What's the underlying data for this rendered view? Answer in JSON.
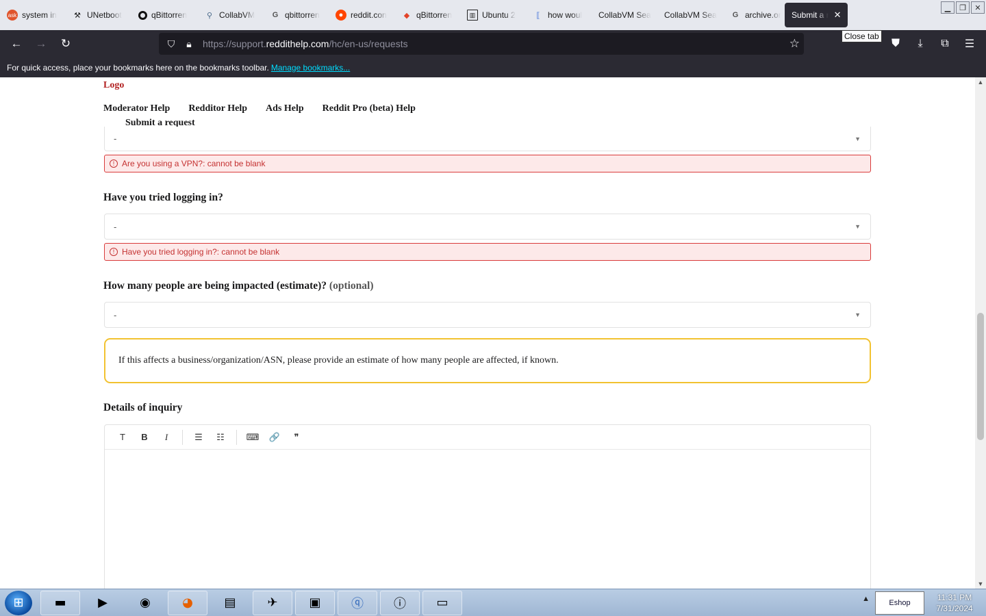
{
  "browser": {
    "tabs": [
      {
        "label": "system in",
        "icon": "ask-icon",
        "color": "#e0542c"
      },
      {
        "label": "UNetboot",
        "icon": "hammer-icon",
        "color": "#333333"
      },
      {
        "label": "qBittorren",
        "icon": "search-ring-icon",
        "color": "#111111"
      },
      {
        "label": "CollabVM",
        "icon": "python-icon",
        "color": "#4b6a8a"
      },
      {
        "label": "qbittorren",
        "icon": "google-icon",
        "color": "#555555"
      },
      {
        "label": "reddit.con",
        "icon": "reddit-icon",
        "color": "#ff4500"
      },
      {
        "label": "qBittorren",
        "icon": "git-icon",
        "color": "#e24329"
      },
      {
        "label": "Ubuntu 2",
        "icon": "columns-icon",
        "color": "#222222"
      },
      {
        "label": "how woul",
        "icon": "bracket-doc-icon",
        "color": "#3d6fd8"
      },
      {
        "label": "CollabVM Sea",
        "icon": "",
        "color": ""
      },
      {
        "label": "CollabVM Sea",
        "icon": "",
        "color": ""
      },
      {
        "label": "archive.or",
        "icon": "google-icon",
        "color": "#555555"
      },
      {
        "label": "Submit a r",
        "icon": "",
        "color": "",
        "active": true
      }
    ],
    "tooltip": "Close tab",
    "url_prefix": "https://support.",
    "url_domain": "reddithelp.com",
    "url_path": "/hc/en-us/requests",
    "bookmarks_text": "For quick access, place your bookmarks here on the bookmarks toolbar.",
    "bookmarks_link": "Manage bookmarks..."
  },
  "page": {
    "logo": "Logo",
    "nav": [
      "Moderator Help",
      "Redditor Help",
      "Ads Help",
      "Reddit Pro (beta) Help"
    ],
    "submit_link": "Submit a request",
    "vpn_select": "-",
    "vpn_error": "Are you using a VPN?: cannot be blank",
    "login_label": "Have you tried logging in?",
    "login_select": "-",
    "login_error": "Have you tried logging in?: cannot be blank",
    "impact_label": "How many people are being impacted (estimate)?",
    "impact_optional": "(optional)",
    "impact_select": "-",
    "impact_hint": "If this affects a business/organization/ASN, please provide an estimate of how many people are affected, if known.",
    "details_label": "Details of inquiry",
    "toolbar": {
      "text": "T",
      "bold": "B",
      "italic": "I",
      "bullets": "☰",
      "numbers": "☷",
      "code": "⌨",
      "link": "🔗",
      "quote": "❞"
    }
  },
  "taskbar": {
    "tray_text": "Eshop",
    "time": "11:31 PM",
    "date": "7/31/2024"
  },
  "colors": {
    "error_border": "#d93a3a",
    "error_bg": "#fde9e9",
    "hint_border": "#f2c230",
    "browser_dark": "#2b2a33",
    "link_cyan": "#00ddff"
  }
}
